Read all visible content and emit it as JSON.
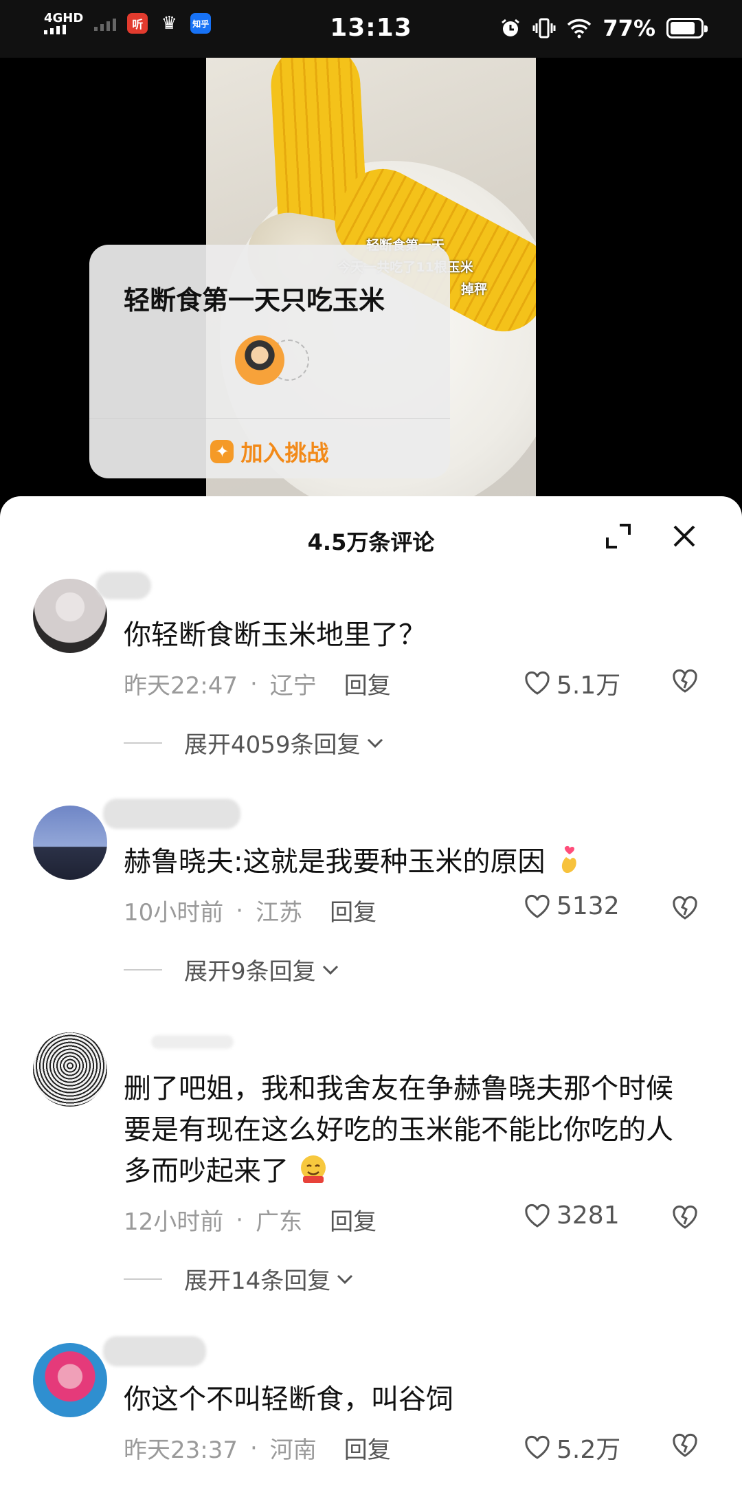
{
  "status_bar": {
    "network": "4GHD",
    "time": "13:13",
    "battery": "77%",
    "app_icons": [
      "听",
      "♛",
      "知乎"
    ]
  },
  "video": {
    "overlay_line1": "轻断食第一天",
    "overlay_line2": "今天一共吃了11根玉米",
    "overlay_line3": "掉秤",
    "challenge_title": "轻断食第一天只吃玉米",
    "challenge_join": "加入挑战"
  },
  "comments_sheet": {
    "title": "4.5万条评论",
    "comments": [
      {
        "text": "你轻断食断玉米地里了？",
        "time": "昨天22:47",
        "location": "辽宁",
        "reply_label": "回复",
        "likes": "5.1万",
        "expand_label": "展开4059条回复"
      },
      {
        "text": "赫鲁晓夫:这就是我要种玉米的原因",
        "time": "10小时前",
        "location": "江苏",
        "reply_label": "回复",
        "likes": "5132",
        "expand_label": "展开9条回复"
      },
      {
        "text": "删了吧姐，我和我舍友在争赫鲁晓夫那个时候要是有现在这么好吃的玉米能不能比你吃的人多而吵起来了",
        "time": "12小时前",
        "location": "广东",
        "reply_label": "回复",
        "likes": "3281",
        "expand_label": "展开14条回复"
      },
      {
        "text": "你这个不叫轻断食，叫谷饲",
        "time": "昨天23:37",
        "location": "河南",
        "reply_label": "回复",
        "likes": "5.2万"
      }
    ]
  },
  "colors": {
    "accent_orange": "#f28a19",
    "meta_gray": "#9a9a9a"
  }
}
